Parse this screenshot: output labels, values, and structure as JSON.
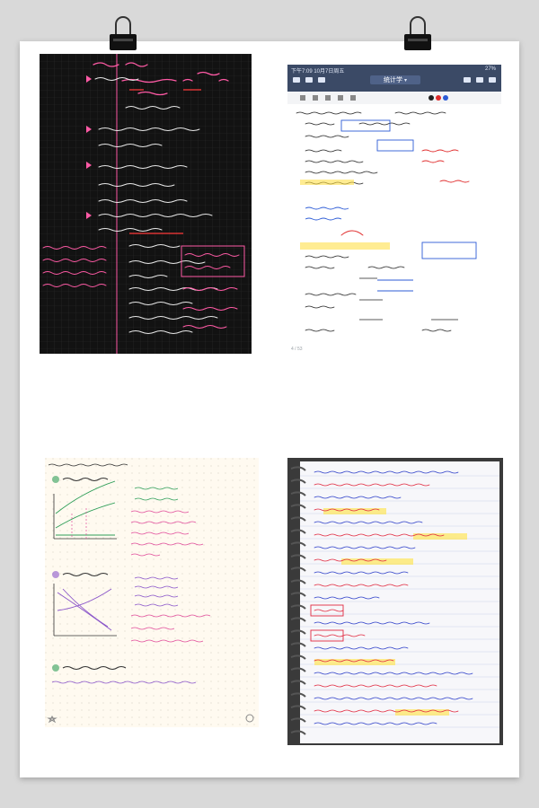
{
  "poster": {
    "clips": [
      "left-binder-clip",
      "right-binder-clip"
    ]
  },
  "panels": {
    "top_left": {
      "style": "handwritten notes on black grid paper",
      "palette": {
        "background": "#121212",
        "grid": "#2a2a2a",
        "pink": "#ff5aa5",
        "white": "#f2f2f2",
        "red": "#ff3b3b"
      }
    },
    "top_right": {
      "app_bar": {
        "status_left": "下午7:09  10月7日周五",
        "status_right": "27%",
        "doc_title": "统计学",
        "dropdown_marker": "▾",
        "page_counter": "4 / 53"
      },
      "palette": {
        "app_bar": "#3b4a66",
        "paper": "#ffffff",
        "ink": "#222222",
        "blue": "#2c5bd6",
        "red": "#e02b2b",
        "highlight": "#ffe04a"
      }
    },
    "bottom_left": {
      "header_line": "知识卡片",
      "palette": {
        "paper": "#fffaf0",
        "dots": "#d8d2c6",
        "ink": "#333333",
        "green": "#2e9e58",
        "purple": "#8a55c9",
        "pink": "#e04d9a"
      }
    },
    "bottom_right": {
      "palette": {
        "paper": "#f7f7fa",
        "lines": "#c9d2ea",
        "blue": "#2d3fc9",
        "red": "#e0283f",
        "highlight": "#ffe65a",
        "spiral": "#555555"
      }
    }
  }
}
